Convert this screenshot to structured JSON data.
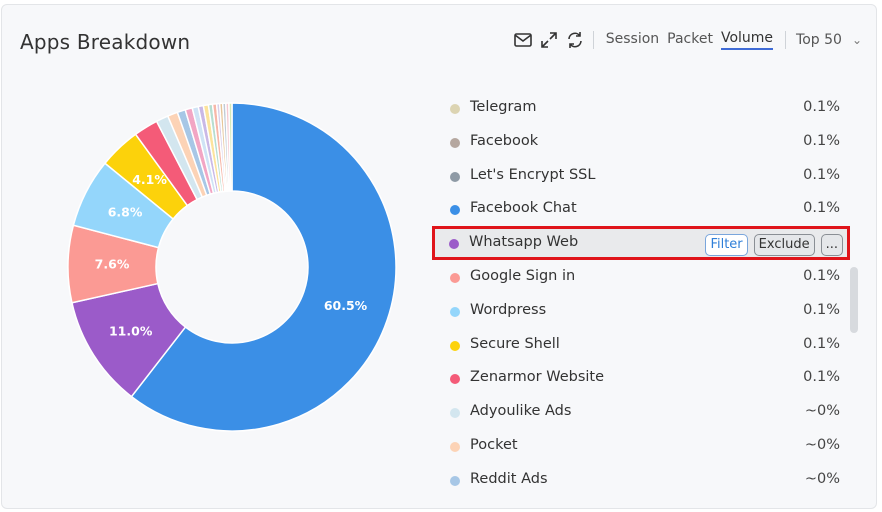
{
  "header": {
    "title": "Apps Breakdown"
  },
  "toolbar": {
    "tabs": [
      "Session",
      "Packet",
      "Volume"
    ],
    "active_tab": "Volume",
    "top_select": "Top 50",
    "icons": [
      "mail-icon",
      "expand-icon",
      "refresh-icon"
    ]
  },
  "chart_data": {
    "type": "pie",
    "donut": true,
    "slices": [
      {
        "value": 60.5,
        "label": "60.5%",
        "color": "#3b8fe6"
      },
      {
        "value": 11.0,
        "label": "11.0%",
        "color": "#9b5bc9"
      },
      {
        "value": 7.6,
        "label": "7.6%",
        "color": "#fb9a94"
      },
      {
        "value": 6.8,
        "label": "6.8%",
        "color": "#94d6fb"
      },
      {
        "value": 4.1,
        "label": "4.1%",
        "color": "#fcd20b"
      },
      {
        "value": 2.4,
        "label": "",
        "color": "#f45b78"
      },
      {
        "value": 1.2,
        "label": "",
        "color": "#d3e6ef"
      },
      {
        "value": 1.0,
        "label": "",
        "color": "#fcd3b6"
      },
      {
        "value": 0.8,
        "label": "",
        "color": "#a7c7e6"
      },
      {
        "value": 0.7,
        "label": "",
        "color": "#f2a6c4"
      },
      {
        "value": 0.6,
        "label": "",
        "color": "#cfe3f5"
      },
      {
        "value": 0.5,
        "label": "",
        "color": "#c9b8e6"
      },
      {
        "value": 0.5,
        "label": "",
        "color": "#fce39c"
      },
      {
        "value": 0.4,
        "label": "",
        "color": "#b7ded1"
      },
      {
        "value": 0.4,
        "label": "",
        "color": "#f7b7a8"
      },
      {
        "value": 0.3,
        "label": "",
        "color": "#d9cfe9"
      },
      {
        "value": 0.3,
        "label": "",
        "color": "#e6c69a"
      },
      {
        "value": 0.3,
        "label": "",
        "color": "#bfcbd6"
      },
      {
        "value": 0.3,
        "label": "",
        "color": "#f6c8d0"
      },
      {
        "value": 0.3,
        "label": "",
        "color": "#d4e8b8"
      }
    ]
  },
  "legend": [
    {
      "name": "Telegram",
      "value": "0.1%",
      "color": "#dcd4b2"
    },
    {
      "name": "Facebook",
      "value": "0.1%",
      "color": "#b5a79f"
    },
    {
      "name": "Let's Encrypt SSL",
      "value": "0.1%",
      "color": "#8e9aa5"
    },
    {
      "name": "Facebook Chat",
      "value": "0.1%",
      "color": "#3b8fe6"
    },
    {
      "name": "Whatsapp Web",
      "value": "",
      "color": "#9b5bc9",
      "highlighted": true
    },
    {
      "name": "Google Sign in",
      "value": "0.1%",
      "color": "#fb9a94"
    },
    {
      "name": "Wordpress",
      "value": "0.1%",
      "color": "#94d6fb"
    },
    {
      "name": "Secure Shell",
      "value": "0.1%",
      "color": "#fcd20b"
    },
    {
      "name": "Zenarmor Website",
      "value": "0.1%",
      "color": "#f45b78"
    },
    {
      "name": "Adyoulike Ads",
      "value": "~0%",
      "color": "#d3e6ef"
    },
    {
      "name": "Pocket",
      "value": "~0%",
      "color": "#fcd3b6"
    },
    {
      "name": "Reddit Ads",
      "value": "~0%",
      "color": "#a7c7e6"
    }
  ],
  "row_actions": {
    "filter": "Filter",
    "exclude": "Exclude",
    "more": "..."
  },
  "colors": {
    "highlight_border": "#e0141a",
    "active_tab": "#3f6bd6"
  }
}
